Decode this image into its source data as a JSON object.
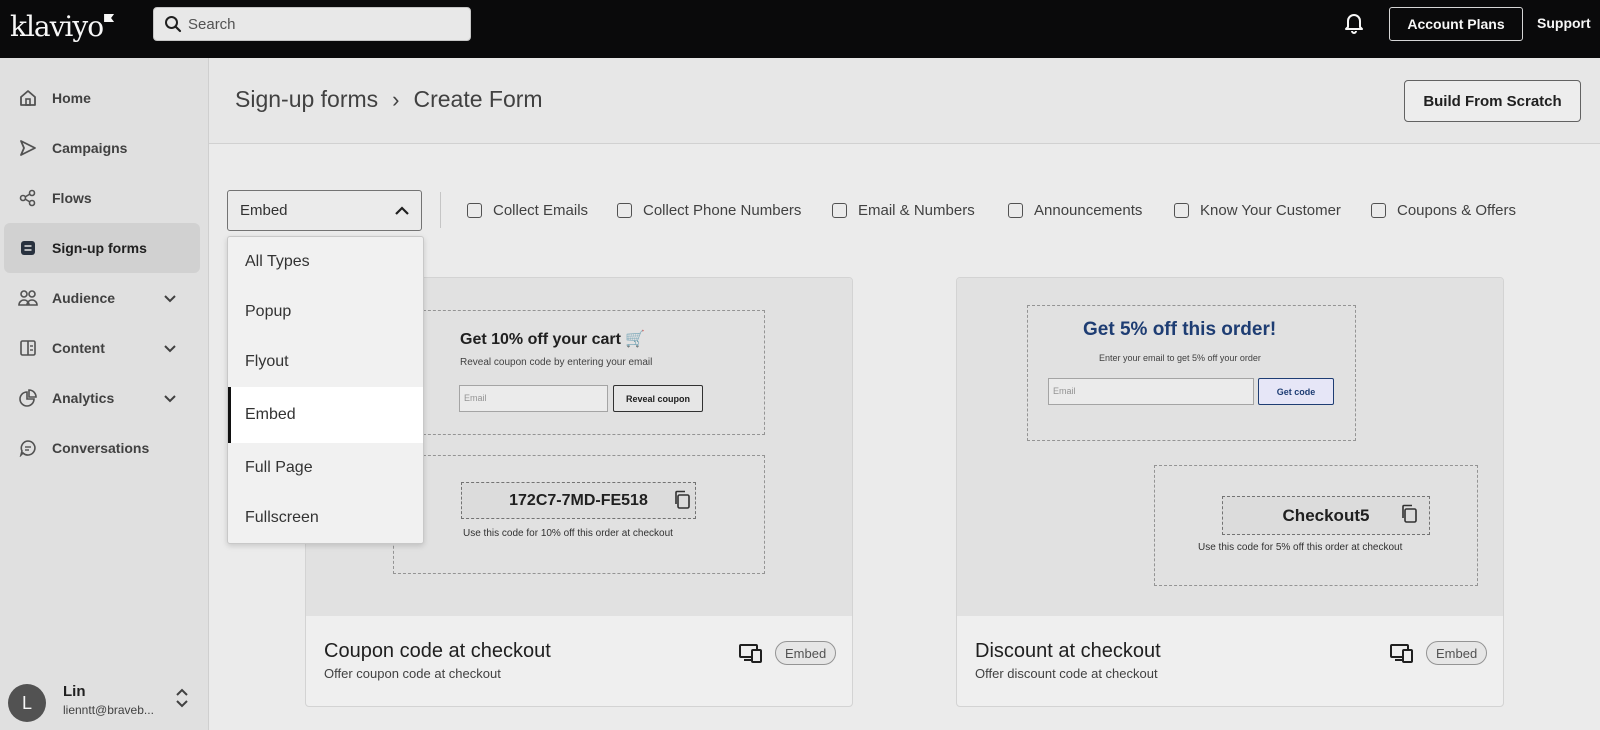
{
  "topbar": {
    "brand": "klaviyo",
    "search_placeholder": "Search",
    "account_plans": "Account Plans",
    "support": "Support"
  },
  "sidebar": {
    "items": [
      {
        "label": "Home",
        "icon": "home-icon"
      },
      {
        "label": "Campaigns",
        "icon": "send-icon"
      },
      {
        "label": "Flows",
        "icon": "flows-icon"
      },
      {
        "label": "Sign-up forms",
        "icon": "form-icon",
        "active": true
      },
      {
        "label": "Audience",
        "icon": "people-icon",
        "expandable": true
      },
      {
        "label": "Content",
        "icon": "content-icon",
        "expandable": true
      },
      {
        "label": "Analytics",
        "icon": "analytics-icon",
        "expandable": true
      },
      {
        "label": "Conversations",
        "icon": "chat-icon"
      }
    ],
    "user": {
      "initial": "L",
      "name": "Lin",
      "email": "lienntt@braveb..."
    }
  },
  "header": {
    "crumb_root": "Sign-up forms",
    "crumb_sep": "›",
    "crumb_current": "Create Form",
    "build_button": "Build From Scratch"
  },
  "filters": {
    "type_select": "Embed",
    "checkboxes": [
      "Collect Emails",
      "Collect Phone Numbers",
      "Email & Numbers",
      "Announcements",
      "Know Your Customer",
      "Coupons & Offers"
    ]
  },
  "type_menu": {
    "options": [
      "All Types",
      "Popup",
      "Flyout",
      "Embed",
      "Full Page",
      "Fullscreen"
    ],
    "selected": "Embed"
  },
  "cards": [
    {
      "title": "Coupon code at checkout",
      "subtitle": "Offer coupon code at checkout",
      "badge": "Embed",
      "preview": {
        "heading": "Get 10% off  your cart 🛒",
        "sub": "Reveal coupon code by entering your email",
        "input_placeholder": "Email",
        "button": "Reveal coupon",
        "code": "172C7-7MD-FE518",
        "note": "Use this code for 10% off this order at checkout"
      }
    },
    {
      "title": "Discount at checkout",
      "subtitle": "Offer discount code at checkout",
      "badge": "Embed",
      "preview": {
        "heading": "Get 5% off this order!",
        "sub": "Enter your email to get 5% off your order",
        "input_placeholder": "Email",
        "button": "Get code",
        "code": "Checkout5",
        "note": "Use this code for 5% off this order at checkout",
        "heading_color": "#1f3f77"
      }
    }
  ]
}
